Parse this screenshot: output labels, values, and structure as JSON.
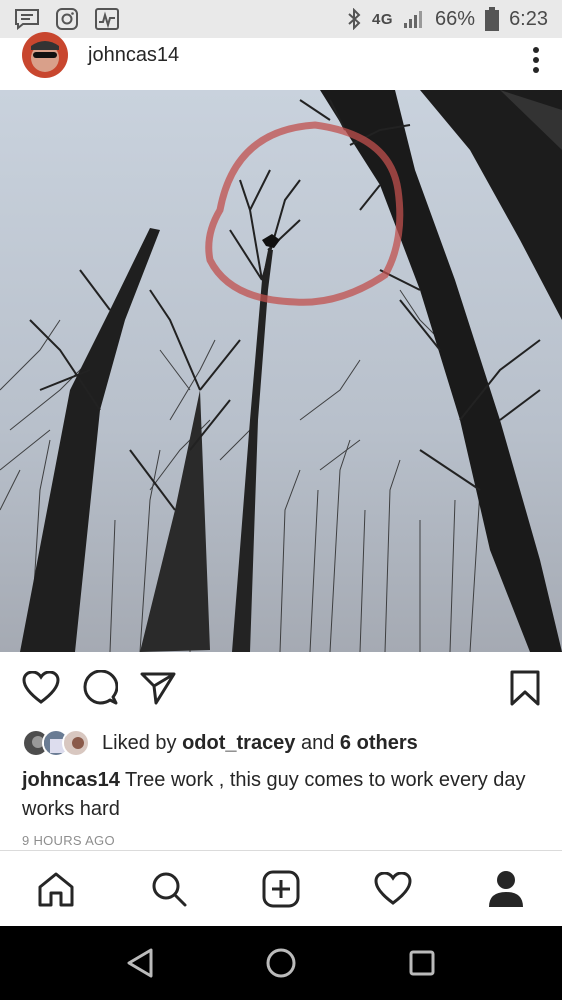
{
  "status_bar": {
    "network": "4G",
    "battery": "66%",
    "time": "6:23",
    "icons": [
      "message-icon",
      "instagram-icon",
      "activity-icon",
      "bluetooth-icon",
      "signal-icon",
      "battery-icon"
    ]
  },
  "post": {
    "username": "johncas14",
    "likes": {
      "prefix": "Liked by ",
      "user": "odot_tracey",
      "middle": " and ",
      "others": "6 others"
    },
    "caption": {
      "user": "johncas14",
      "text": " Tree work , this guy comes to work every day works hard"
    },
    "time_ago": "9 HOURS AGO",
    "highlight_color": "#c0504d"
  },
  "nav": {
    "items": [
      "home-icon",
      "search-icon",
      "new-post-icon",
      "activity-heart-icon",
      "profile-icon"
    ]
  },
  "system_nav": {
    "items": [
      "back-icon",
      "home-circle-icon",
      "recents-icon"
    ]
  }
}
